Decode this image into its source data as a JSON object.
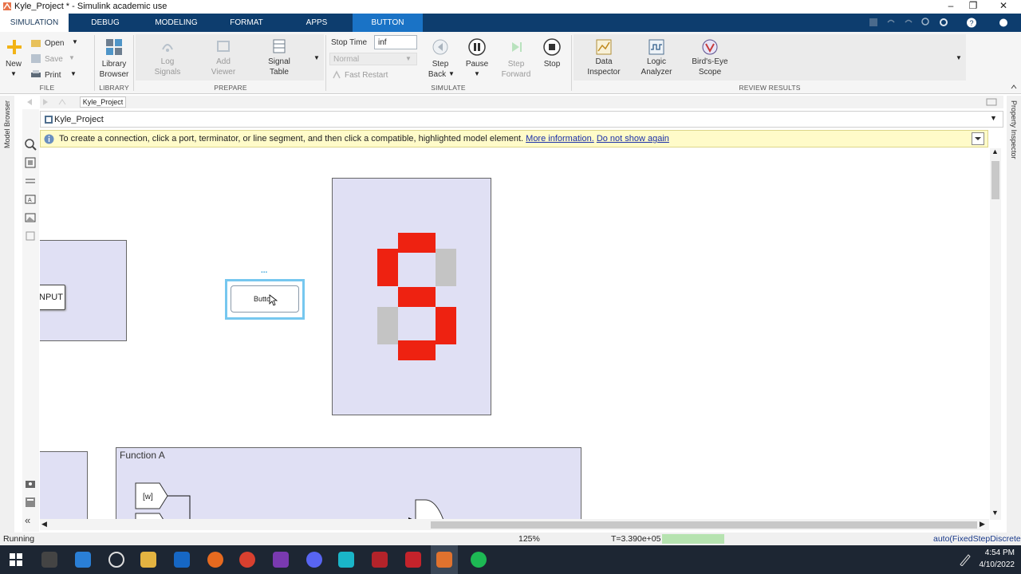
{
  "window": {
    "title": "Kyle_Project * - Simulink academic use",
    "minimize": "–",
    "restore": "❐",
    "close": "✕"
  },
  "tabs": [
    {
      "label": "SIMULATION"
    },
    {
      "label": "DEBUG"
    },
    {
      "label": "MODELING"
    },
    {
      "label": "FORMAT"
    },
    {
      "label": "APPS"
    },
    {
      "label": "BUTTON"
    }
  ],
  "ribbon": {
    "file": {
      "new": "New",
      "open": "Open",
      "save": "Save",
      "print": "Print",
      "section": "FILE"
    },
    "library": {
      "browser_line1": "Library",
      "browser_line2": "Browser",
      "section": "LIBRARY"
    },
    "prepare": {
      "log_line1": "Log",
      "log_line2": "Signals",
      "add_line1": "Add",
      "add_line2": "Viewer",
      "table_line1": "Signal",
      "table_line2": "Table",
      "section": "PREPARE"
    },
    "simulate": {
      "stop_time_label": "Stop Time",
      "stop_time_value": "inf",
      "mode_value": "Normal",
      "fast_restart": "Fast Restart",
      "step_back_line1": "Step",
      "step_back_line2": "Back",
      "pause": "Pause",
      "step_fwd_line1": "Step",
      "step_fwd_line2": "Forward",
      "stop": "Stop",
      "section": "SIMULATE"
    },
    "review": {
      "data_line1": "Data",
      "data_line2": "Inspector",
      "logic_line1": "Logic",
      "logic_line2": "Analyzer",
      "birds_line1": "Bird's-Eye",
      "birds_line2": "Scope",
      "section": "REVIEW RESULTS"
    }
  },
  "breadcrumb": {
    "tab": "Kyle_Project",
    "path": "Kyle_Project"
  },
  "side_panels": {
    "left": "Model Browser",
    "right": "Property Inspector"
  },
  "infobar": {
    "message": "To create a connection, click a port, terminator, or line segment, and then click a compatible, highlighted model element.",
    "more_info": "More information.",
    "dont_show": "Do not show again"
  },
  "canvas": {
    "input_label": "NPUT",
    "button_label": "Button",
    "button_dots": "...",
    "function_title": "Function A",
    "goto_label": "[w]",
    "segment_on_color": "#ee2211",
    "segment_off_color": "#c4c4c4",
    "subsystem_fill": "#e0e0f4"
  },
  "status": {
    "state": "Running",
    "zoom": "125%",
    "time": "T=3.390e+05",
    "progress": 1.0,
    "solver": "auto(FixedStepDiscrete)"
  },
  "taskbar": {
    "time": "4:54 PM",
    "date": "4/10/2022"
  }
}
